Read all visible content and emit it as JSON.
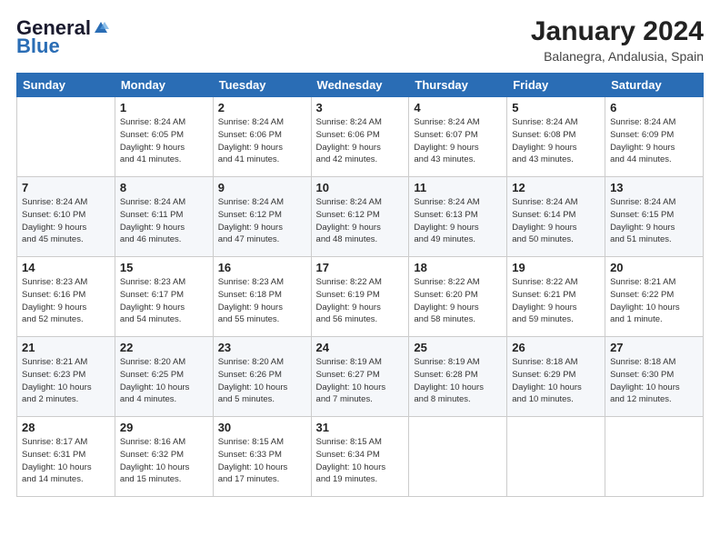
{
  "logo": {
    "general": "General",
    "blue": "Blue"
  },
  "header": {
    "month_year": "January 2024",
    "location": "Balanegra, Andalusia, Spain"
  },
  "days_of_week": [
    "Sunday",
    "Monday",
    "Tuesday",
    "Wednesday",
    "Thursday",
    "Friday",
    "Saturday"
  ],
  "weeks": [
    [
      {
        "day": "",
        "info": ""
      },
      {
        "day": "1",
        "info": "Sunrise: 8:24 AM\nSunset: 6:05 PM\nDaylight: 9 hours\nand 41 minutes."
      },
      {
        "day": "2",
        "info": "Sunrise: 8:24 AM\nSunset: 6:06 PM\nDaylight: 9 hours\nand 41 minutes."
      },
      {
        "day": "3",
        "info": "Sunrise: 8:24 AM\nSunset: 6:06 PM\nDaylight: 9 hours\nand 42 minutes."
      },
      {
        "day": "4",
        "info": "Sunrise: 8:24 AM\nSunset: 6:07 PM\nDaylight: 9 hours\nand 43 minutes."
      },
      {
        "day": "5",
        "info": "Sunrise: 8:24 AM\nSunset: 6:08 PM\nDaylight: 9 hours\nand 43 minutes."
      },
      {
        "day": "6",
        "info": "Sunrise: 8:24 AM\nSunset: 6:09 PM\nDaylight: 9 hours\nand 44 minutes."
      }
    ],
    [
      {
        "day": "7",
        "info": "Sunrise: 8:24 AM\nSunset: 6:10 PM\nDaylight: 9 hours\nand 45 minutes."
      },
      {
        "day": "8",
        "info": "Sunrise: 8:24 AM\nSunset: 6:11 PM\nDaylight: 9 hours\nand 46 minutes."
      },
      {
        "day": "9",
        "info": "Sunrise: 8:24 AM\nSunset: 6:12 PM\nDaylight: 9 hours\nand 47 minutes."
      },
      {
        "day": "10",
        "info": "Sunrise: 8:24 AM\nSunset: 6:12 PM\nDaylight: 9 hours\nand 48 minutes."
      },
      {
        "day": "11",
        "info": "Sunrise: 8:24 AM\nSunset: 6:13 PM\nDaylight: 9 hours\nand 49 minutes."
      },
      {
        "day": "12",
        "info": "Sunrise: 8:24 AM\nSunset: 6:14 PM\nDaylight: 9 hours\nand 50 minutes."
      },
      {
        "day": "13",
        "info": "Sunrise: 8:24 AM\nSunset: 6:15 PM\nDaylight: 9 hours\nand 51 minutes."
      }
    ],
    [
      {
        "day": "14",
        "info": "Sunrise: 8:23 AM\nSunset: 6:16 PM\nDaylight: 9 hours\nand 52 minutes."
      },
      {
        "day": "15",
        "info": "Sunrise: 8:23 AM\nSunset: 6:17 PM\nDaylight: 9 hours\nand 54 minutes."
      },
      {
        "day": "16",
        "info": "Sunrise: 8:23 AM\nSunset: 6:18 PM\nDaylight: 9 hours\nand 55 minutes."
      },
      {
        "day": "17",
        "info": "Sunrise: 8:22 AM\nSunset: 6:19 PM\nDaylight: 9 hours\nand 56 minutes."
      },
      {
        "day": "18",
        "info": "Sunrise: 8:22 AM\nSunset: 6:20 PM\nDaylight: 9 hours\nand 58 minutes."
      },
      {
        "day": "19",
        "info": "Sunrise: 8:22 AM\nSunset: 6:21 PM\nDaylight: 9 hours\nand 59 minutes."
      },
      {
        "day": "20",
        "info": "Sunrise: 8:21 AM\nSunset: 6:22 PM\nDaylight: 10 hours\nand 1 minute."
      }
    ],
    [
      {
        "day": "21",
        "info": "Sunrise: 8:21 AM\nSunset: 6:23 PM\nDaylight: 10 hours\nand 2 minutes."
      },
      {
        "day": "22",
        "info": "Sunrise: 8:20 AM\nSunset: 6:25 PM\nDaylight: 10 hours\nand 4 minutes."
      },
      {
        "day": "23",
        "info": "Sunrise: 8:20 AM\nSunset: 6:26 PM\nDaylight: 10 hours\nand 5 minutes."
      },
      {
        "day": "24",
        "info": "Sunrise: 8:19 AM\nSunset: 6:27 PM\nDaylight: 10 hours\nand 7 minutes."
      },
      {
        "day": "25",
        "info": "Sunrise: 8:19 AM\nSunset: 6:28 PM\nDaylight: 10 hours\nand 8 minutes."
      },
      {
        "day": "26",
        "info": "Sunrise: 8:18 AM\nSunset: 6:29 PM\nDaylight: 10 hours\nand 10 minutes."
      },
      {
        "day": "27",
        "info": "Sunrise: 8:18 AM\nSunset: 6:30 PM\nDaylight: 10 hours\nand 12 minutes."
      }
    ],
    [
      {
        "day": "28",
        "info": "Sunrise: 8:17 AM\nSunset: 6:31 PM\nDaylight: 10 hours\nand 14 minutes."
      },
      {
        "day": "29",
        "info": "Sunrise: 8:16 AM\nSunset: 6:32 PM\nDaylight: 10 hours\nand 15 minutes."
      },
      {
        "day": "30",
        "info": "Sunrise: 8:15 AM\nSunset: 6:33 PM\nDaylight: 10 hours\nand 17 minutes."
      },
      {
        "day": "31",
        "info": "Sunrise: 8:15 AM\nSunset: 6:34 PM\nDaylight: 10 hours\nand 19 minutes."
      },
      {
        "day": "",
        "info": ""
      },
      {
        "day": "",
        "info": ""
      },
      {
        "day": "",
        "info": ""
      }
    ]
  ]
}
